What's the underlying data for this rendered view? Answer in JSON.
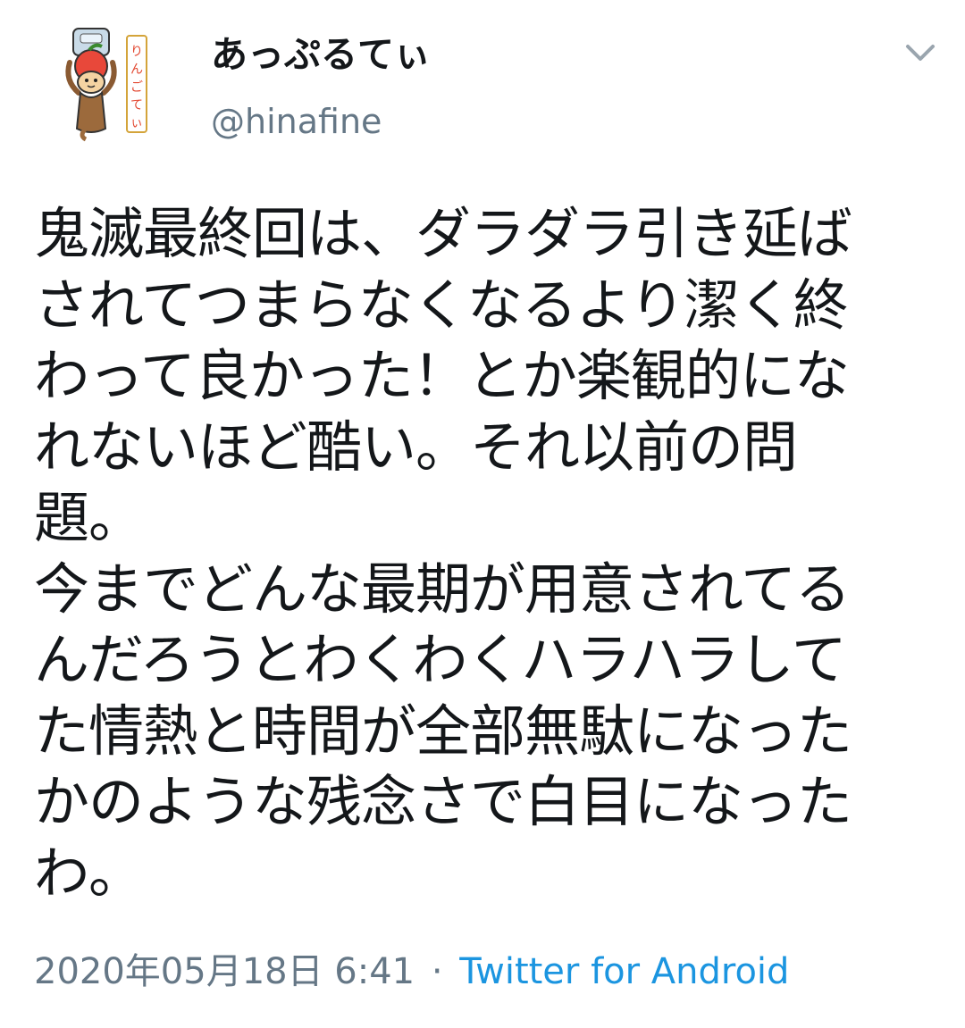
{
  "user": {
    "display_name": "あっぷるてぃ",
    "handle": "@hinafine",
    "avatar_icon": "cartoon-apple-monkey-avatar",
    "avatar_sign_text": "りんごてぃ"
  },
  "menu": {
    "caret_icon": "chevron-down-icon"
  },
  "tweet": {
    "lines": [
      "鬼滅最終回は、ダラダラ引き延ば",
      "されてつまらなくなるより潔く終",
      "わって良かった！とか楽観的にな",
      "れないほど酷い。それ以前の問",
      "題。",
      "今までどんな最期が用意されてる",
      "んだろうとわくわくハラハラして",
      "た情熱と時間が全部無駄になった",
      "かのような残念さで白目になった",
      "わ。"
    ]
  },
  "meta": {
    "timestamp": "2020年05月18日 6:41",
    "separator": "·",
    "source": "Twitter for Android"
  },
  "colors": {
    "text": "#14171a",
    "secondary": "#657786",
    "link": "#1b95e0"
  }
}
